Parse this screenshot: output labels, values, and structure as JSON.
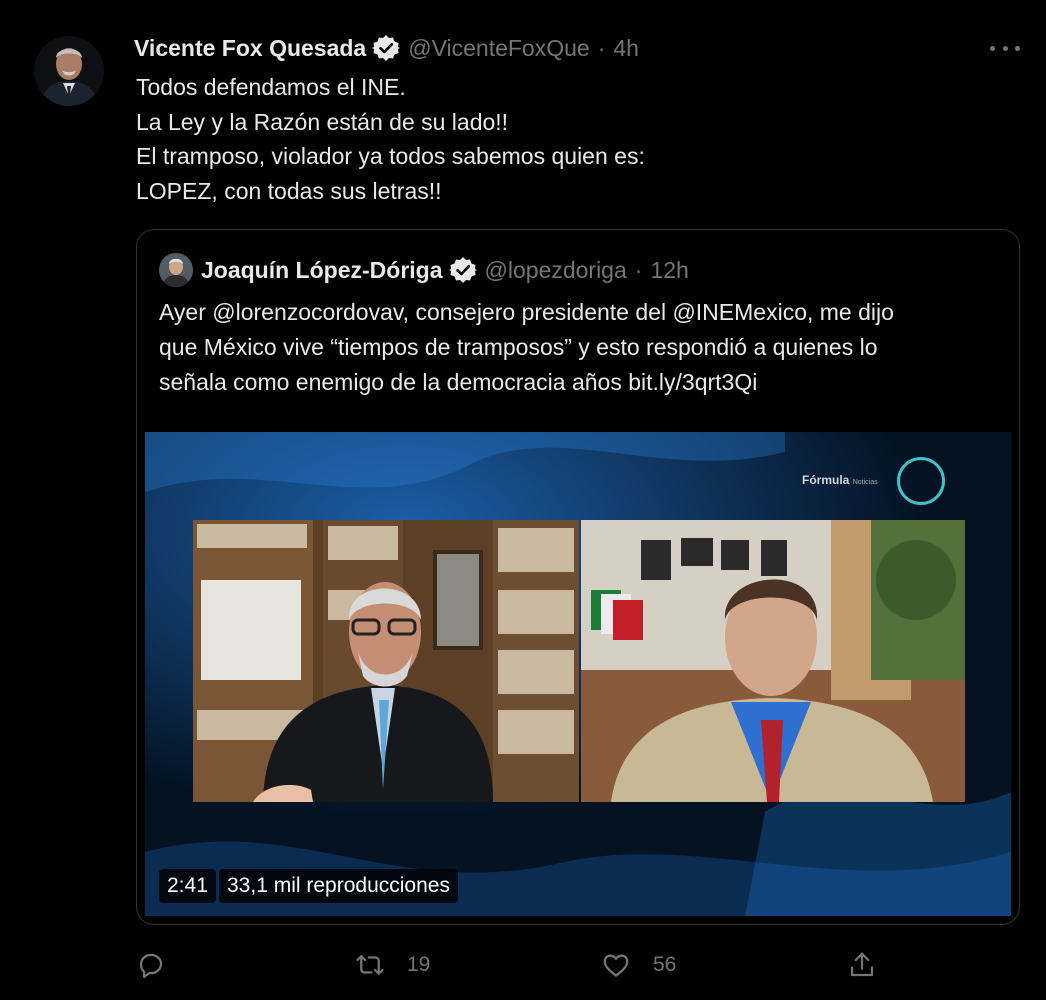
{
  "tweet": {
    "author_name": "Vicente Fox Quesada",
    "handle": "@VicenteFoxQue",
    "separator": "·",
    "time": "4h",
    "lines": [
      "Todos defendamos el INE.",
      "La Ley y la Razón están de su lado!!",
      "El tramposo, violador ya todos sabemos quien es:",
      "LOPEZ, con todas sus letras!!"
    ]
  },
  "quote": {
    "author_name": "Joaquín López-Dóriga",
    "handle": "@lopezdoriga",
    "separator": "·",
    "time": "12h",
    "lines": [
      "Ayer @lorenzocordovav, consejero presidente del @INEMexico, me dijo",
      "que México vive “tiempos de tramposos” y esto respondió a quienes lo",
      "señala como enemigo de la democracia años bit.ly/3qrt3Qi"
    ],
    "video": {
      "duration": "2:41",
      "views": "33,1 mil reproducciones",
      "channel_logo_text": "Fórmula",
      "channel_logo_sub": "Noticias"
    }
  },
  "actions": {
    "reply_count": "",
    "retweet_count": "19",
    "like_count": "56"
  },
  "colors": {
    "background": "#000000",
    "text": "#e7e9ea",
    "muted": "#71767b",
    "border": "#2f3336"
  }
}
